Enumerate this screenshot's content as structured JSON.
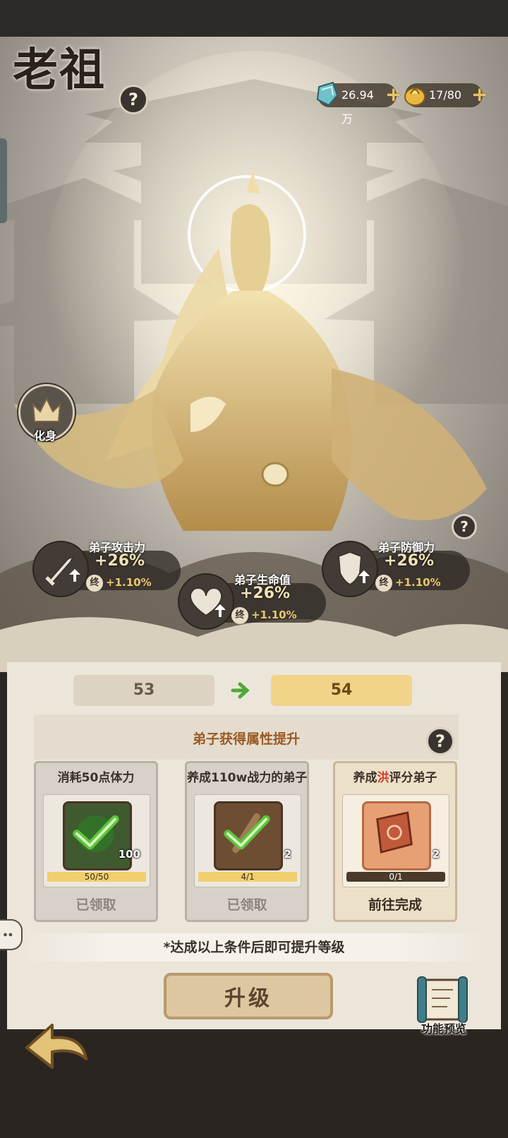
{
  "header": {
    "title": "老祖",
    "resources": [
      {
        "icon": "spirit-stone-icon",
        "value": "26.94万"
      },
      {
        "icon": "gold-ingot-icon",
        "value": "17/80"
      }
    ]
  },
  "avatar_button": {
    "label": "化身"
  },
  "stats": [
    {
      "name": "弟子攻击力",
      "value": "+26%",
      "badge": "终",
      "increment": "+1.10%",
      "icon": "sword-icon"
    },
    {
      "name": "弟子生命值",
      "value": "+26%",
      "badge": "终",
      "increment": "+1.10%",
      "icon": "heart-icon"
    },
    {
      "name": "弟子防御力",
      "value": "+26%",
      "badge": "终",
      "increment": "+1.10%",
      "icon": "shield-icon"
    }
  ],
  "levels": {
    "current": "53",
    "next": "54"
  },
  "section_title": "弟子获得属性提升",
  "tasks": [
    {
      "title_before": "消耗50点体力",
      "title_highlight": "",
      "title_after": "",
      "item_count": "100",
      "progress_text": "50/50",
      "progress": 1.0,
      "action": "已领取",
      "done": true
    },
    {
      "title_before": "养成110w战力的弟子",
      "title_highlight": "",
      "title_after": "",
      "item_count": "2",
      "progress_text": "4/1",
      "progress": 1.0,
      "action": "已领取",
      "done": true
    },
    {
      "title_before": "养成",
      "title_highlight": "洪",
      "title_after": "评分弟子",
      "item_count": "2",
      "progress_text": "0/1",
      "progress": 0.0,
      "action": "前往完成",
      "done": false
    }
  ],
  "note": "*达成以上条件后即可提升等级",
  "upgrade_button": "升级",
  "preview_button": "功能预览",
  "colors": {
    "accent": "#f1cf6f",
    "highlight": "#d23b2a",
    "check": "#5cc63b"
  }
}
